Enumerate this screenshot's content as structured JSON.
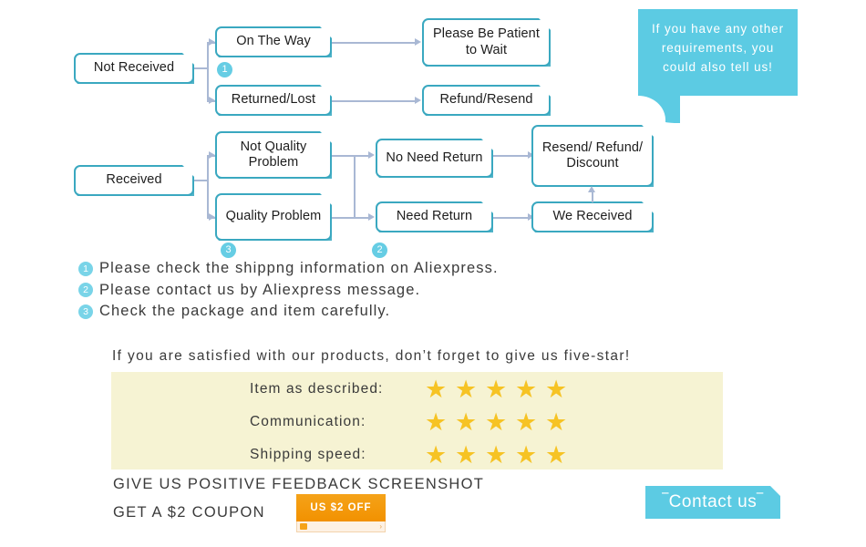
{
  "flowchart": {
    "row1": {
      "root": "Not Received",
      "branches": [
        "On The Way",
        "Returned/Lost"
      ],
      "outcomes": [
        "Please Be Patient to Wait",
        "Refund/Resend"
      ],
      "badge": "1"
    },
    "row2": {
      "root": "Received",
      "branches": [
        "Not Quality Problem",
        "Quality Problem"
      ],
      "middle": [
        "No Need Return",
        "Need Return"
      ],
      "outcomes": [
        "Resend/ Refund/ Discount",
        "We Received"
      ],
      "badge_quality": "3",
      "badge_return": "2"
    }
  },
  "bubble": {
    "text": "If you have any other requirements, you could also tell us!"
  },
  "notes": [
    {
      "num": "1",
      "text": "Please check the shippng information on Aliexpress."
    },
    {
      "num": "2",
      "text": "Please contact us by Aliexpress message."
    },
    {
      "num": "3",
      "text": "Check the package and item carefully."
    }
  ],
  "feedback": {
    "headline": "If you are satisfied with our products, don’t forget to give us five-star!",
    "rows": [
      {
        "label": "Item as described:",
        "stars": 5
      },
      {
        "label": "Communication:",
        "stars": 5
      },
      {
        "label": "Shipping speed:",
        "stars": 5
      }
    ],
    "star_glyph": "★"
  },
  "bottom": {
    "line1": "GIVE US POSITIVE FEEDBACK SCREENSHOT",
    "line2": "GET A $2 COUPON",
    "coupon_label": "US $2 OFF",
    "coupon_chevron": "›",
    "contact_label": "‾Contact us‾"
  },
  "colors": {
    "box_border": "#3aa8c0",
    "accent_cyan": "#5ccbe3",
    "connector": "#a9b8d4",
    "panel_yellow": "#f6f3d3",
    "star": "#f6c324",
    "coupon_orange": "#f29100"
  }
}
